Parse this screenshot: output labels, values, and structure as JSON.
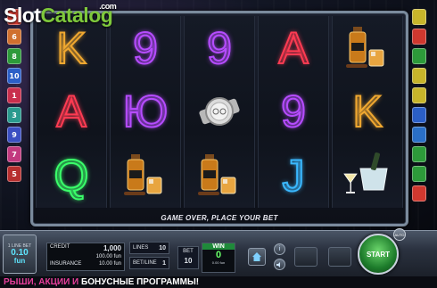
{
  "logo": {
    "main": "Slot",
    "accent": "Catalog",
    "suffix": ".com"
  },
  "lines_left": [
    {
      "num": "2",
      "color": "#d0382f"
    },
    {
      "num": "6",
      "color": "#d0702f"
    },
    {
      "num": "8",
      "color": "#2d9a3a"
    },
    {
      "num": "10",
      "color": "#2b5fc7"
    },
    {
      "num": "1",
      "color": "#c92f4d"
    },
    {
      "num": "3",
      "color": "#2a9a8e"
    },
    {
      "num": "9",
      "color": "#3b4fc2"
    },
    {
      "num": "7",
      "color": "#c2397f"
    },
    {
      "num": "5",
      "color": "#b72f2f"
    }
  ],
  "lines_right": [
    {
      "color": "#c7b52b"
    },
    {
      "color": "#d0382f"
    },
    {
      "color": "#2d9a3a"
    },
    {
      "color": "#c7b52b"
    },
    {
      "color": "#c7b52b"
    },
    {
      "color": "#2b5fc7"
    },
    {
      "color": "#2a6fc7"
    },
    {
      "color": "#2d9a3a"
    },
    {
      "color": "#2d9a3a"
    },
    {
      "color": "#d0382f"
    }
  ],
  "reels": [
    [
      {
        "sym": "K",
        "color": "#f0a830"
      },
      {
        "sym": "A",
        "color": "#ff3b52"
      },
      {
        "sym": "Q",
        "color": "#3aff6a"
      }
    ],
    [
      {
        "sym": "9",
        "color": "#b64cff"
      },
      {
        "sym": "Ю",
        "color": "#b64cff"
      },
      {
        "sym": "whiskey",
        "color": "#e08a1e"
      }
    ],
    [
      {
        "sym": "9",
        "color": "#b64cff"
      },
      {
        "sym": "watch",
        "color": "#cfcfcf"
      },
      {
        "sym": "whiskey",
        "color": "#e08a1e"
      }
    ],
    [
      {
        "sym": "A",
        "color": "#ff3b52"
      },
      {
        "sym": "9",
        "color": "#b64cff"
      },
      {
        "sym": "J",
        "color": "#3ab8ff"
      }
    ],
    [
      {
        "sym": "whiskey",
        "color": "#e08a1e"
      },
      {
        "sym": "K",
        "color": "#f0a830"
      },
      {
        "sym": "champagne",
        "color": "#c9dfe6"
      }
    ]
  ],
  "status": "GAME OVER, PLACE YOUR BET",
  "panel": {
    "line_bet_label": "1 LINE BET",
    "line_bet_value": "0.10",
    "line_bet_unit": "fun",
    "credit_label": "CREDIT",
    "credit_value": "1,000",
    "credit_sub": "100.00 fun",
    "insurance_label": "INSURANCE",
    "insurance_value": "10.00 fun",
    "lines_label": "LINES",
    "lines_value": "10",
    "betline_label": "BET/LINE",
    "betline_value": "1",
    "bet_label": "BET",
    "bet_value": "10",
    "win_label": "WIN",
    "win_value": "0",
    "win_sub": "0.00 fun",
    "start_label": "START",
    "auto_label": "AUTO"
  },
  "ticker": {
    "pink": "РЫШИ, АКЦИИ И",
    "white": " БОНУСНЫЕ ПРОГРАММЫ!"
  }
}
